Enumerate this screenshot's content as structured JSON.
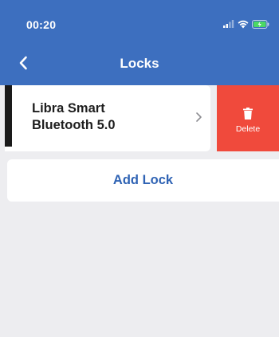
{
  "status_bar": {
    "time": "00:20",
    "icons": [
      "signal-icon",
      "wifi-icon",
      "battery-charging-icon"
    ],
    "battery_color": "#4cd964"
  },
  "nav": {
    "title": "Locks",
    "back_icon": "chevron-left-icon"
  },
  "locks": [
    {
      "name": "Libra Smart Bluetooth 5.0",
      "chevron_icon": "chevron-right-icon",
      "delete_label": "Delete",
      "delete_icon": "trash-icon"
    }
  ],
  "add_lock_label": "Add Lock",
  "colors": {
    "header": "#3d6fbf",
    "delete": "#f04a3c",
    "accent_text": "#2f63b4",
    "background": "#ededf0"
  }
}
